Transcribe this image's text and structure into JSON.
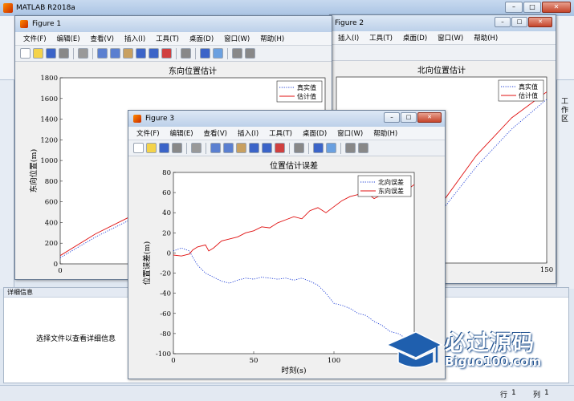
{
  "main_window": {
    "title": "MATLAB R2018a",
    "right_panel_label": "工作区"
  },
  "details": {
    "header": "详细信息",
    "message": "选择文件以查看详细信息"
  },
  "status": {
    "row_label": "行",
    "row_value": "1",
    "col_label": "列",
    "col_value": "1"
  },
  "menu": [
    "文件(F)",
    "编辑(E)",
    "查看(V)",
    "插入(I)",
    "工具(T)",
    "桌面(D)",
    "窗口(W)",
    "帮助(H)"
  ],
  "menu_partial": [
    "插入(I)",
    "工具(T)",
    "桌面(D)",
    "窗口(W)",
    "帮助(H)"
  ],
  "figure1": {
    "title": "Figure 1"
  },
  "figure2": {
    "title": "Figure 2"
  },
  "figure3": {
    "title": "Figure 3"
  },
  "watermark": {
    "line1": "必过源码",
    "line2": "Biguo100.com"
  },
  "chart_data": [
    {
      "id": "figure1",
      "type": "line",
      "title": "东向位置估计",
      "xlabel": "",
      "ylabel": "东向位置(m)",
      "xlim": [
        0,
        150
      ],
      "ylim": [
        0,
        1800
      ],
      "xticks": [
        0
      ],
      "yticks": [
        0,
        200,
        400,
        600,
        800,
        1000,
        1200,
        1400,
        1600,
        1800
      ],
      "legend_position": "top-right",
      "series": [
        {
          "name": "真实值",
          "style": "dotted",
          "color": "#1f3fd6",
          "x": [
            0,
            20,
            40,
            60,
            80
          ],
          "y": [
            60,
            260,
            430,
            600,
            780
          ]
        },
        {
          "name": "估计值",
          "style": "solid",
          "color": "#e01010",
          "x": [
            0,
            20,
            40,
            60,
            80
          ],
          "y": [
            80,
            290,
            460,
            640,
            810
          ]
        }
      ]
    },
    {
      "id": "figure2",
      "type": "line",
      "title": "北向位置估计",
      "xlabel": "",
      "ylabel": "",
      "xlim": [
        0,
        150
      ],
      "xticks": [
        150
      ],
      "legend_position": "top-right",
      "series": [
        {
          "name": "真实值",
          "style": "dotted",
          "color": "#1f3fd6",
          "x": [
            75,
            100,
            125,
            150
          ],
          "y": [
            -260,
            -140,
            -40,
            40
          ]
        },
        {
          "name": "估计值",
          "style": "solid",
          "color": "#e01010",
          "x": [
            75,
            100,
            125,
            150
          ],
          "y": [
            -240,
            -110,
            -10,
            60
          ]
        }
      ]
    },
    {
      "id": "figure3",
      "type": "line",
      "title": "位置估计误差",
      "xlabel": "时刻(s)",
      "ylabel": "位置误差(m)",
      "xlim": [
        0,
        150
      ],
      "ylim": [
        -100,
        80
      ],
      "xticks": [
        0,
        50,
        100,
        150
      ],
      "yticks": [
        -100,
        -80,
        -60,
        -40,
        -20,
        0,
        20,
        40,
        60,
        80
      ],
      "legend_position": "top-right",
      "series": [
        {
          "name": "北向误差",
          "style": "dotted",
          "color": "#1f3fd6",
          "x": [
            0,
            5,
            10,
            12,
            15,
            20,
            25,
            30,
            35,
            40,
            45,
            50,
            55,
            60,
            65,
            70,
            75,
            80,
            85,
            90,
            95,
            100,
            105,
            110,
            115,
            120,
            125,
            130,
            135,
            140,
            145,
            150
          ],
          "y": [
            2,
            5,
            2,
            -4,
            -12,
            -20,
            -24,
            -28,
            -30,
            -27,
            -25,
            -26,
            -24,
            -25,
            -26,
            -25,
            -27,
            -25,
            -28,
            -32,
            -40,
            -50,
            -52,
            -55,
            -60,
            -62,
            -68,
            -72,
            -78,
            -80,
            -85,
            -90
          ]
        },
        {
          "name": "东向误差",
          "style": "solid",
          "color": "#e01010",
          "x": [
            0,
            5,
            10,
            12,
            15,
            20,
            22,
            25,
            30,
            35,
            40,
            45,
            50,
            55,
            60,
            65,
            70,
            75,
            80,
            85,
            90,
            95,
            100,
            105,
            110,
            115,
            120,
            125,
            130,
            135,
            140,
            145,
            150
          ],
          "y": [
            -2,
            -3,
            -1,
            3,
            6,
            8,
            2,
            5,
            12,
            14,
            16,
            20,
            22,
            26,
            25,
            30,
            33,
            36,
            34,
            42,
            45,
            40,
            46,
            52,
            56,
            58,
            60,
            54,
            58,
            62,
            60,
            62,
            68
          ]
        }
      ]
    }
  ]
}
